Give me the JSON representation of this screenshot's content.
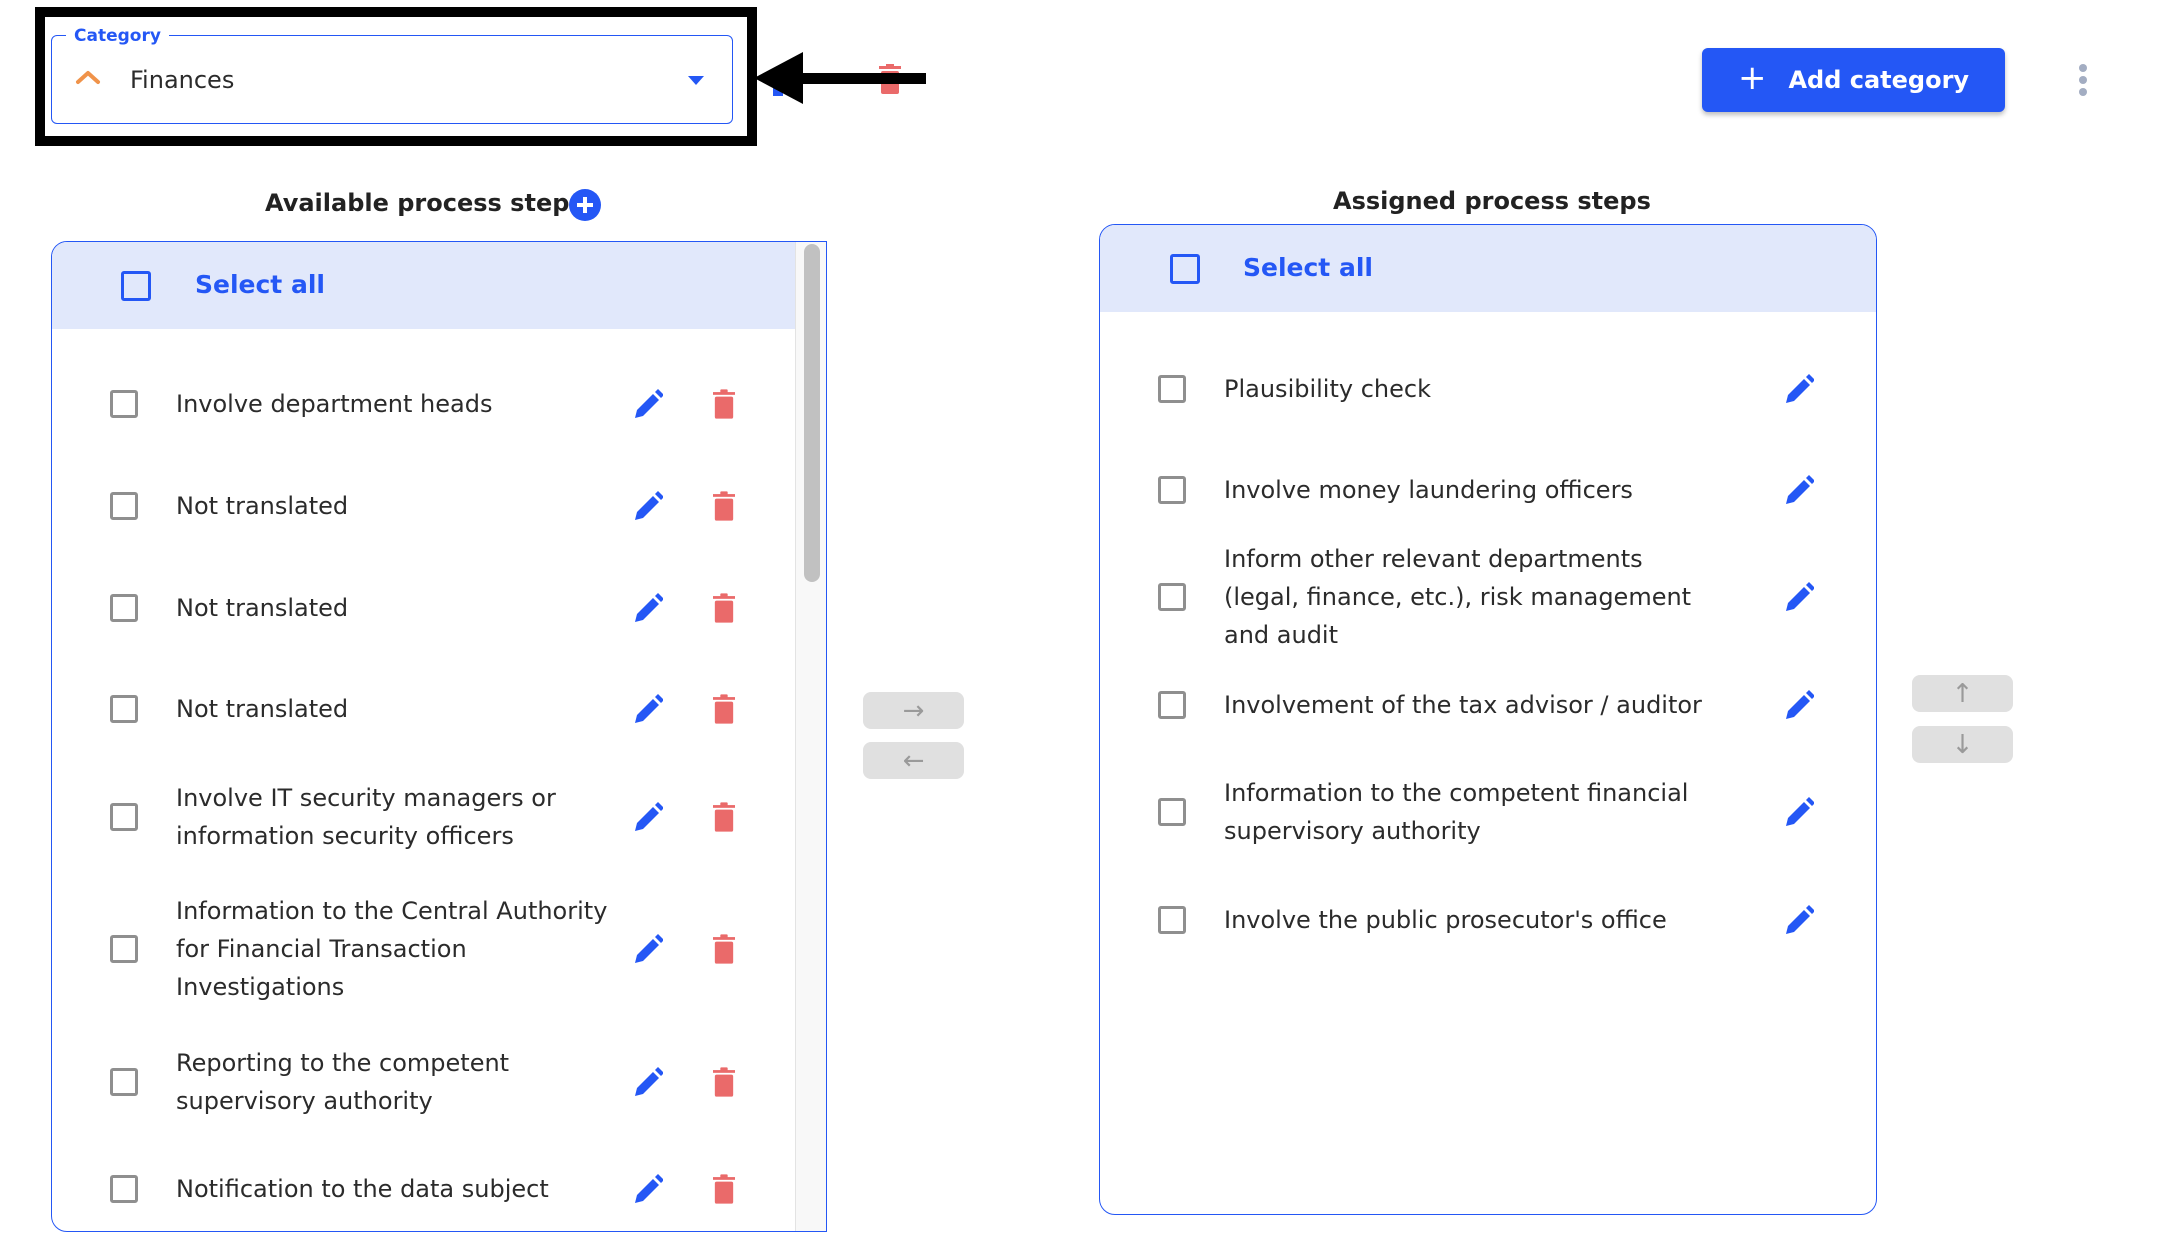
{
  "category": {
    "label": "Category",
    "value": "Finances",
    "chevron_color": "#f0934a"
  },
  "toolbar": {
    "add_category_label": "Add category",
    "add_icon": "plus-icon",
    "menu_icon": "more-vert-icon"
  },
  "available": {
    "title": "Available process steps",
    "add_icon": "plus-circle-icon",
    "select_all_label": "Select all",
    "items": [
      {
        "label": "Involve department heads"
      },
      {
        "label": "Not translated"
      },
      {
        "label": "Not translated"
      },
      {
        "label": "Not translated"
      },
      {
        "label": "Involve IT security managers or information security officers"
      },
      {
        "label": "Information to the Central Authority for Financial Transaction Investigations"
      },
      {
        "label": "Reporting to the competent supervisory authority"
      },
      {
        "label": "Notification to the data subject"
      }
    ]
  },
  "assigned": {
    "title": "Assigned process steps",
    "select_all_label": "Select all",
    "items": [
      {
        "label": "Plausibility check"
      },
      {
        "label": "Involve money laundering officers"
      },
      {
        "label": "Inform other relevant departments (legal, finance, etc.), risk management and audit"
      },
      {
        "label": "Involvement of the tax advisor / auditor"
      },
      {
        "label": "Information to the competent financial supervisory authority"
      },
      {
        "label": "Involve the public prosecutor's office"
      }
    ]
  },
  "transfer": {
    "move_right": "→",
    "move_left": "←",
    "move_up": "↑",
    "move_down": "↓"
  },
  "colors": {
    "primary": "#2457f5",
    "danger": "#ea6a6a",
    "header_bg": "#e1e8fb",
    "disabled_bg": "#e0e0e0"
  }
}
